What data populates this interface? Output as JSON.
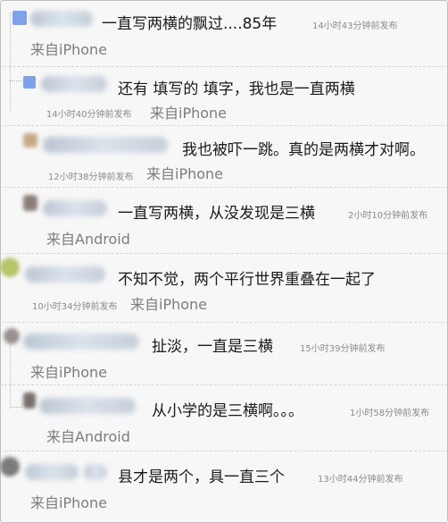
{
  "comments": [
    {
      "text": "一直写两横的飘过....85年",
      "time": "14小时43分钟前发布",
      "source": "来自iPhone"
    },
    {
      "text": "还有 填写的 填字，我也是一直两横",
      "time": "14小时40分钟前发布",
      "source": "来自iPhone"
    },
    {
      "text": "我也被吓一跳。真的是两横才对啊。",
      "time": "12小时38分钟前发布",
      "source": "来自iPhone"
    },
    {
      "text": "一直写两横，从没发现是三横",
      "time": "2小时10分钟前发布",
      "source": "来自Android"
    },
    {
      "text": "不知不觉，两个平行世界重叠在一起了",
      "time": "10小时34分钟前发布",
      "source": "来自iPhone"
    },
    {
      "text": "扯淡，一直是三横",
      "time": "15小时39分钟前发布",
      "source": "来自iPhone"
    },
    {
      "text": "从小学的是三横啊。。。",
      "time": "1小时58分钟前发布",
      "source": "来自Android"
    },
    {
      "text": "县才是两个，具一直三个",
      "time": "13小时44分钟前发布",
      "source": "来自iPhone"
    }
  ],
  "colors": {
    "background": "#f7f7f7",
    "text": "#1a1a1a",
    "meta": "#8a8a8a",
    "source": "#7d7d7d",
    "avatar_blue": "#4f7fd9"
  }
}
